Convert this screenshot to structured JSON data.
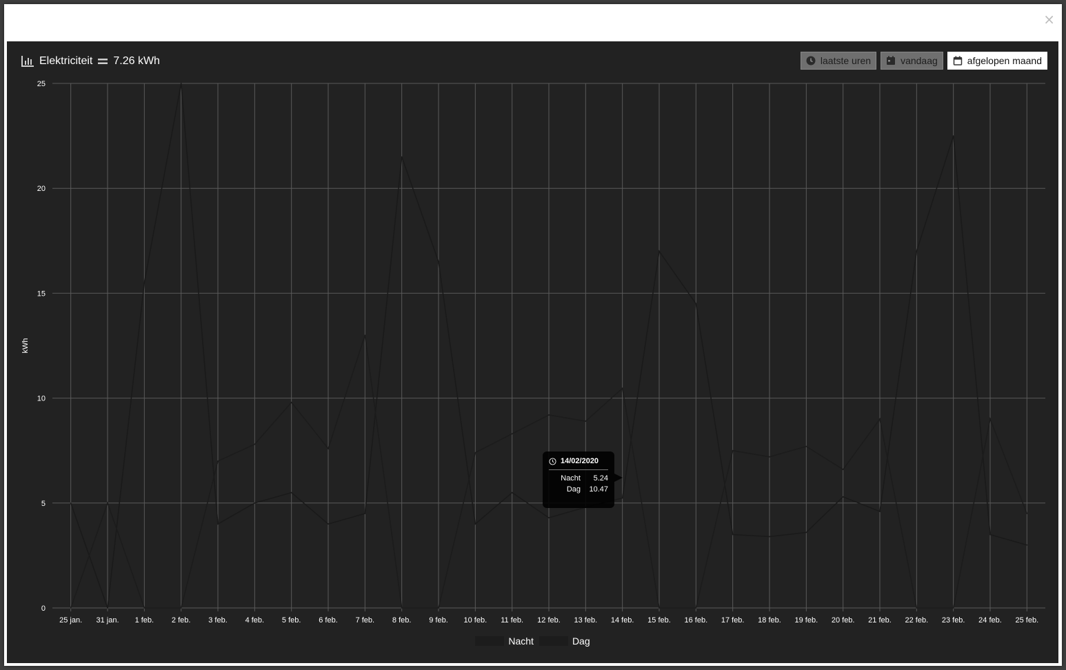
{
  "widget": {
    "title": "Elektriciteit",
    "total": "7.26 kWh"
  },
  "range_buttons": [
    {
      "label": "laatste uren",
      "icon": "clock-icon",
      "active": false
    },
    {
      "label": "vandaag",
      "icon": "calendar-icon",
      "active": false
    },
    {
      "label": "afgelopen maand",
      "icon": "calendar-icon",
      "active": true
    }
  ],
  "close_label": "×",
  "tooltip": {
    "date": "14/02/2020",
    "rows": [
      {
        "label": "Nacht",
        "value": "5.24"
      },
      {
        "label": "Dag",
        "value": "10.47"
      }
    ]
  },
  "chart_data": {
    "type": "line",
    "ylabel": "kWh",
    "ylim": [
      0,
      25
    ],
    "yticks": [
      0,
      5,
      10,
      15,
      20,
      25
    ],
    "x": [
      "25 jan.",
      "31 jan.",
      "1 feb.",
      "2 feb.",
      "3 feb.",
      "4 feb.",
      "5 feb.",
      "6 feb.",
      "7 feb.",
      "8 feb.",
      "9 feb.",
      "10 feb.",
      "11 feb.",
      "12 feb.",
      "13 feb.",
      "14 feb.",
      "15 feb.",
      "16 feb.",
      "17 feb.",
      "18 feb.",
      "19 feb.",
      "20 feb.",
      "21 feb.",
      "22 feb.",
      "23 feb.",
      "24 feb.",
      "25 feb."
    ],
    "series": [
      {
        "name": "Nacht",
        "values": [
          5.0,
          0.0,
          15.5,
          25.0,
          4.0,
          5.0,
          5.5,
          4.0,
          4.5,
          21.5,
          16.5,
          4.0,
          5.5,
          4.3,
          4.8,
          5.24,
          17.0,
          14.5,
          3.5,
          3.4,
          3.6,
          5.3,
          4.6,
          17.0,
          22.5,
          3.5,
          3.0
        ]
      },
      {
        "name": "Dag",
        "values": [
          0.0,
          5.0,
          0.0,
          0.0,
          7.0,
          7.8,
          9.8,
          7.6,
          13.0,
          0.0,
          0.0,
          7.4,
          8.3,
          9.2,
          8.9,
          10.47,
          0.0,
          0.0,
          7.5,
          7.2,
          7.7,
          6.6,
          9.0,
          0.0,
          0.0,
          9.0,
          4.5
        ]
      }
    ],
    "colors": {
      "background": "#222222",
      "grid": "#5a5a5a",
      "line_nacht": "#1a1a1a",
      "line_dag": "#1c1c1c",
      "text": "#ffffff"
    },
    "grid": true,
    "legend": "bottom-center"
  }
}
